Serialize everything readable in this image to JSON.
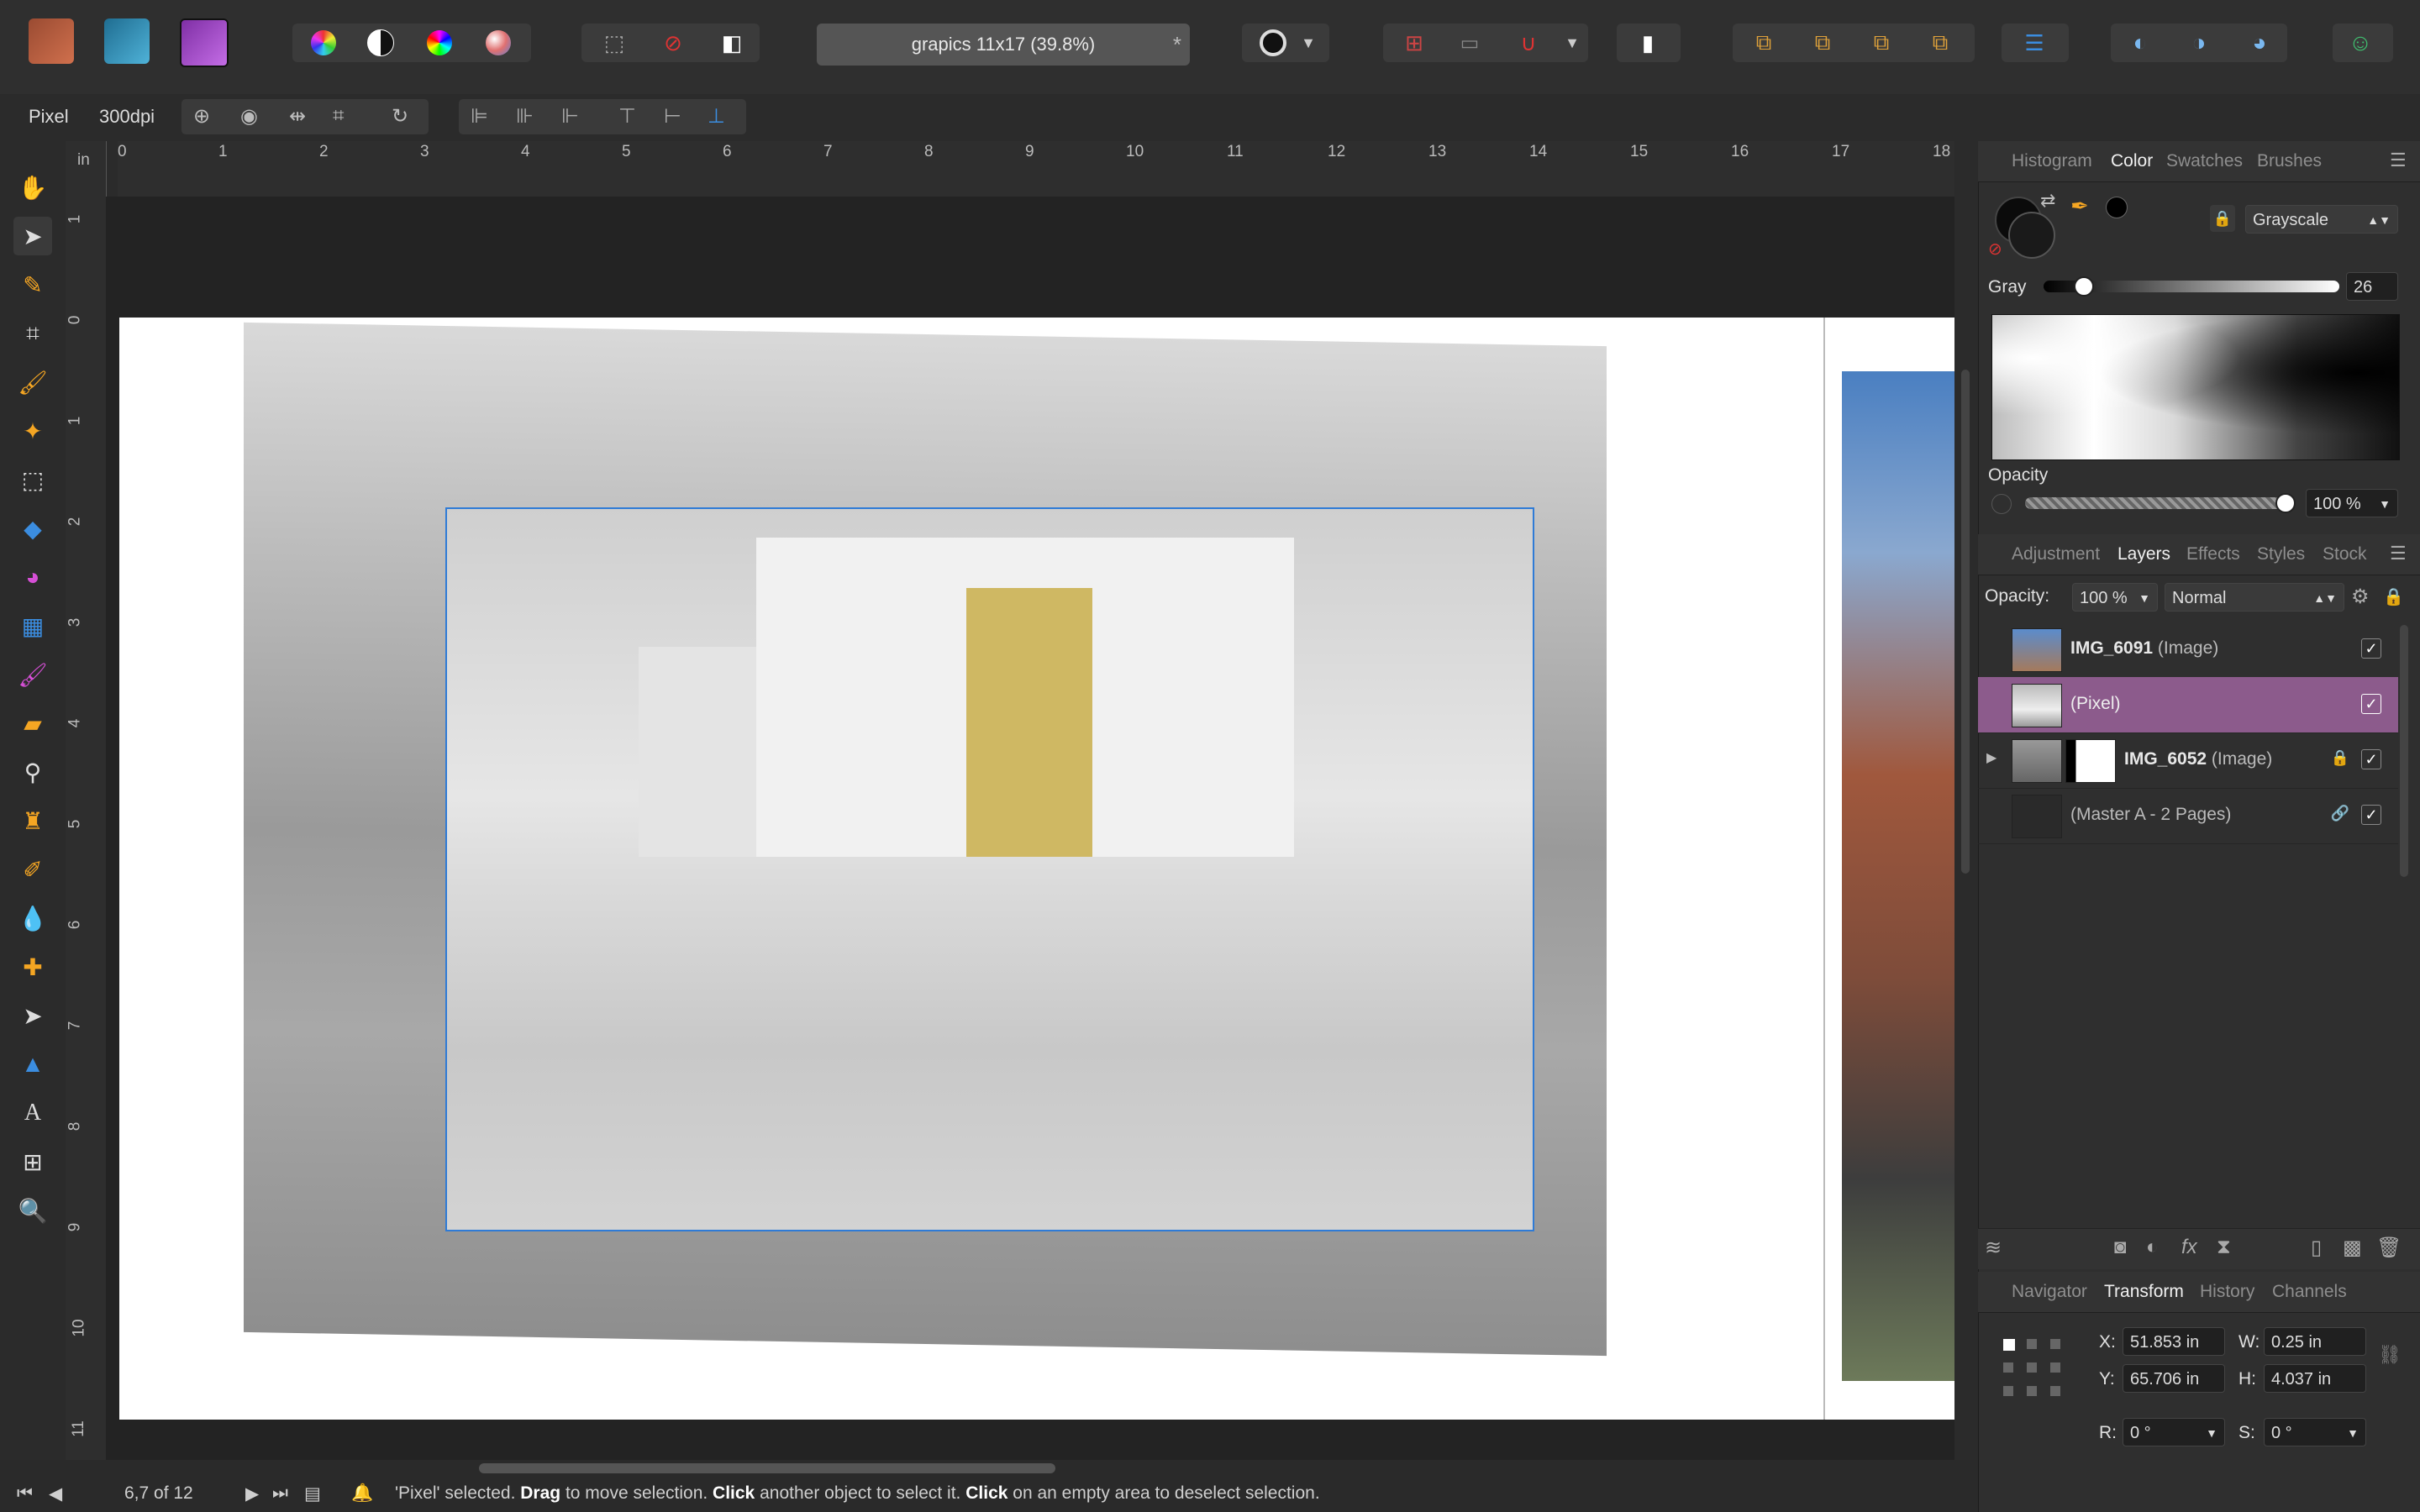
{
  "document": {
    "title": "grapics 11x17 (39.8%)",
    "modified_marker": "*"
  },
  "context_bar": {
    "persona": "Pixel",
    "dpi": "300dpi"
  },
  "ruler": {
    "unit": "in",
    "h_ticks": [
      "0",
      "1",
      "2",
      "3",
      "4",
      "5",
      "6",
      "7",
      "8",
      "9",
      "10",
      "11",
      "12",
      "13",
      "14",
      "15",
      "16",
      "17",
      "18"
    ],
    "v_ticks": [
      "1",
      "0",
      "1",
      "2",
      "3",
      "4",
      "5",
      "6",
      "7",
      "8",
      "9",
      "10",
      "11"
    ]
  },
  "color_panel": {
    "tabs": [
      "Histogram",
      "Color",
      "Swatches",
      "Brushes"
    ],
    "active_tab": "Color",
    "mode": "Grayscale",
    "gray_label": "Gray",
    "gray_value": "26",
    "gray_fraction": 0.13,
    "opacity_label": "Opacity",
    "opacity_value": "100 %"
  },
  "layers_panel": {
    "tabs": [
      "Adjustment",
      "Layers",
      "Effects",
      "Styles",
      "Stock"
    ],
    "active_tab": "Layers",
    "opacity_label": "Opacity:",
    "opacity_value": "100 %",
    "blend_mode": "Normal",
    "layers": [
      {
        "name": "IMG_6091",
        "type": "(Image)",
        "checked": "✓"
      },
      {
        "name": "",
        "type": "(Pixel)",
        "checked": "✓"
      },
      {
        "name": "IMG_6052",
        "type": "(Image)",
        "checked": "✓"
      },
      {
        "name": "",
        "type": "(Master A - 2 Pages)",
        "checked": "✓"
      }
    ]
  },
  "transform_panel": {
    "tabs": [
      "Navigator",
      "Transform",
      "History",
      "Channels"
    ],
    "active_tab": "Transform",
    "x_label": "X:",
    "x_value": "51.853 in",
    "y_label": "Y:",
    "y_value": "65.706 in",
    "w_label": "W:",
    "w_value": "0.25 in",
    "h_label": "H:",
    "h_value": "4.037 in",
    "r_label": "R:",
    "r_value": "0 °",
    "s_label": "S:",
    "s_value": "0 °"
  },
  "status_bar": {
    "pages": "6,7 of 12",
    "msg_1": "'Pixel' selected. ",
    "msg_drag": "Drag",
    "msg_2": " to move selection. ",
    "msg_click": "Click",
    "msg_3": " another object to select it. ",
    "msg_click2": "Click",
    "msg_4": " on an empty area to deselect selection."
  },
  "colors": {
    "accent_selection": "#2f7bd6",
    "selected_layer": "#8c5b8c",
    "gold_facade": "#c9ae4a"
  }
}
